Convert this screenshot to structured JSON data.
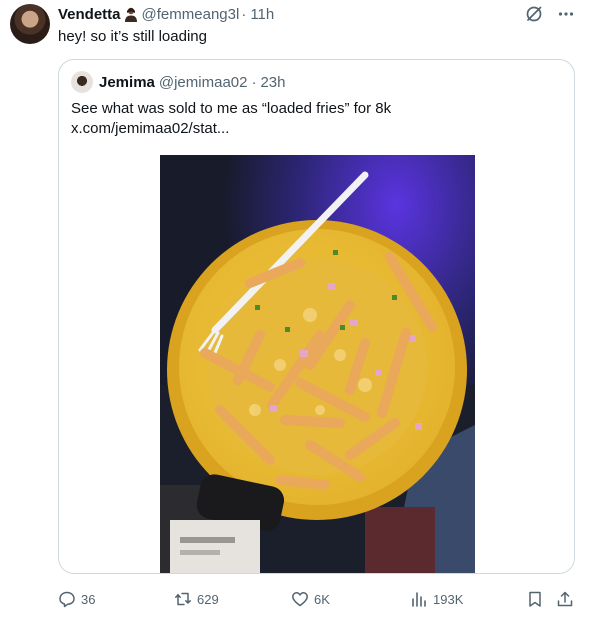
{
  "tweet": {
    "author_name": "Vendetta",
    "author_handle": "@femmeang3l",
    "separator": "·",
    "time": "11h",
    "text": "hey! so it’s still loading"
  },
  "quote": {
    "author_name": "Jemima",
    "author_handle": "@jemimaa02",
    "separator": "·",
    "time": "23h",
    "text_line1": "See what was sold to me as “loaded fries” for 8k",
    "text_line2": "x.com/jemimaa02/stat..."
  },
  "actions": {
    "replies": "36",
    "reposts": "629",
    "likes": "6K",
    "views": "193K"
  },
  "icons": {
    "header_emoji": "person-emoji-icon",
    "grok": "grok-icon",
    "more": "more-icon",
    "reply": "reply-icon",
    "repost": "repost-icon",
    "like": "heart-icon",
    "views": "views-icon",
    "bookmark": "bookmark-icon",
    "share": "share-icon"
  },
  "colors": {
    "text": "#0f1419",
    "secondary": "#536471",
    "border": "#cfd9de"
  }
}
